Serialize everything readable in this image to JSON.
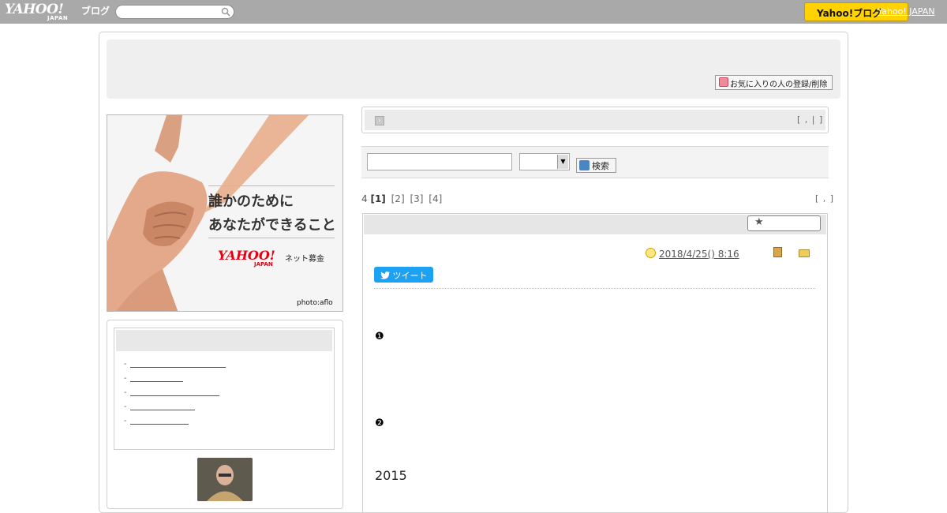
{
  "topbar": {
    "logo_text": "YAHOO!",
    "logo_sub": "JAPAN",
    "blog_label": "ブログ",
    "search_placeholder": "",
    "yahoo_button": "Yahoo!ブログ",
    "yahoo_link": "Yahoo! JAPAN",
    "accent": "#ffd200"
  },
  "header": {
    "favorite_button": "お気に入りの人の登録/削除"
  },
  "banner": {
    "line1": "誰かのために",
    "line2": "あなたができること",
    "logo": "YAHOO!",
    "logo_sub": "JAPAN",
    "tag": "ネット募金",
    "credit": "photo:aflo"
  },
  "sidebar": {
    "items": [
      {
        "prefix": "-"
      },
      {
        "prefix": "-"
      },
      {
        "prefix": "-"
      },
      {
        "prefix": "-"
      },
      {
        "prefix": "-"
      }
    ]
  },
  "info_bar": {
    "right_text": "[ , | ]"
  },
  "search": {
    "input_value": "",
    "select_value": "",
    "button_label": "検索"
  },
  "pager": {
    "count": "4",
    "current": "[1]",
    "pages": [
      "[2]",
      "[3]",
      "[4]"
    ],
    "right_text": "[ , ]"
  },
  "article": {
    "date": "2018/4/25()  8:16",
    "tweet_label": "ツイート",
    "marker1": "❶",
    "marker2": "❷",
    "year": "2015"
  }
}
